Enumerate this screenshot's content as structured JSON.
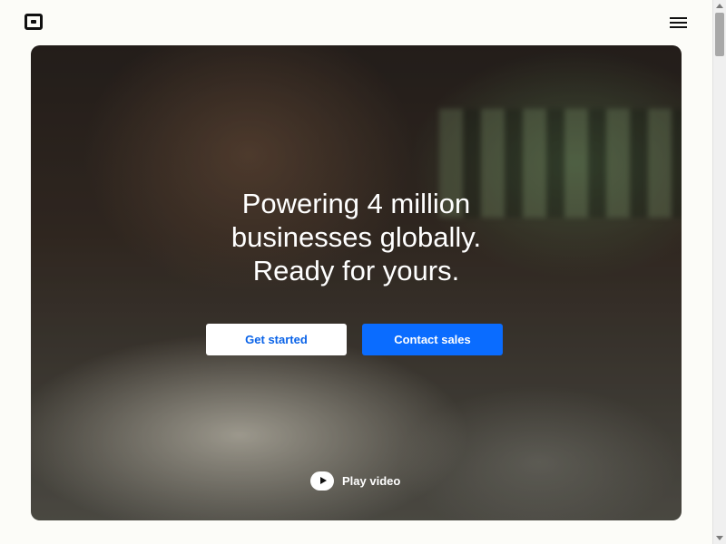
{
  "header": {
    "logo_icon": "square-logo-icon",
    "menu_icon": "hamburger-menu-icon"
  },
  "hero": {
    "headline_lines": [
      "Powering 4 million",
      "businesses globally.",
      "Ready for yours."
    ],
    "primary_button": "Get started",
    "secondary_button": "Contact sales",
    "play_label": "Play video",
    "colors": {
      "primary_button_bg": "#ffffff",
      "primary_button_text": "#0a63e8",
      "secondary_button_bg": "#0a6cff",
      "secondary_button_text": "#ffffff"
    }
  }
}
